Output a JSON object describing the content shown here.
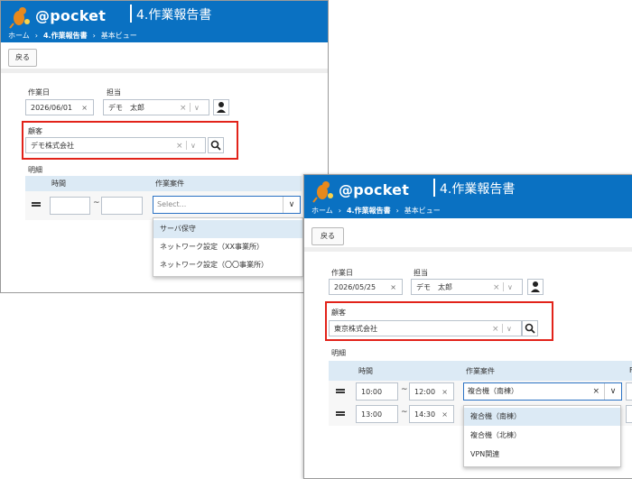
{
  "app": {
    "logo_text": "@pocket"
  },
  "window1": {
    "title": "4.作業報告書",
    "breadcrumb": [
      "ホーム",
      "4.作業報告書",
      "基本ビュー"
    ],
    "back_label": "戻る",
    "work_date_label": "作業日",
    "work_date_value": "2026/06/01",
    "assignee_label": "担当",
    "assignee_value": "デモ　太郎",
    "customer_label": "顧客",
    "customer_value": "デモ株式会社",
    "detail_label": "明細",
    "col_time": "時間",
    "col_project": "作業案件",
    "project_placeholder": "Select...",
    "tilde": "~",
    "dropdown_options": [
      "サーバ保守",
      "ネットワーク設定（XX事業所）",
      "ネットワーク設定（〇〇事業所）"
    ]
  },
  "window2": {
    "title": "4.作業報告書",
    "breadcrumb": [
      "ホーム",
      "4.作業報告書",
      "基本ビュー"
    ],
    "back_label": "戻る",
    "work_date_label": "作業日",
    "work_date_value": "2026/05/25",
    "assignee_label": "担当",
    "assignee_value": "デモ　太郎",
    "customer_label": "顧客",
    "customer_value": "東京株式会社",
    "detail_label": "明細",
    "col_time": "時間",
    "col_project": "作業案件",
    "col_extra": "F",
    "tilde": "~",
    "rows": [
      {
        "start": "10:00",
        "end": "12:00",
        "project": "複合機（南棟）"
      },
      {
        "start": "13:00",
        "end": "14:30",
        "project": ""
      }
    ],
    "dropdown_options": [
      "複合機（南棟）",
      "複合機（北棟）",
      "VPN関連"
    ]
  },
  "colors": {
    "header": "#0a71c2",
    "highlight_box": "#e2231a",
    "grid_header": "#dceaf5"
  }
}
